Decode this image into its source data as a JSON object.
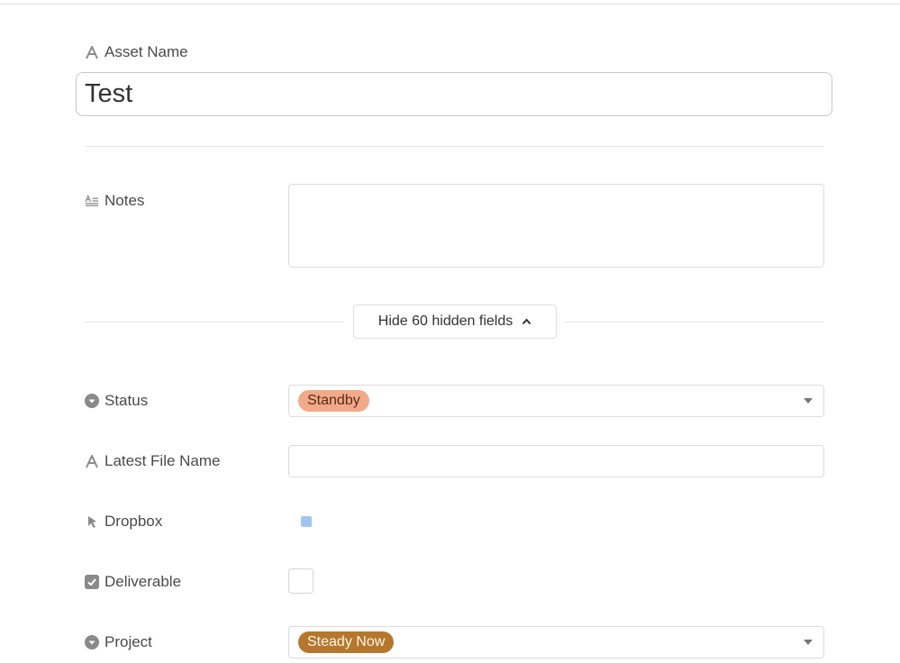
{
  "asset_name": {
    "label": "Asset Name",
    "value": "Test",
    "icon": "text-field-icon"
  },
  "notes": {
    "label": "Notes",
    "value": "",
    "icon": "long-text-icon"
  },
  "hidden_toggle": {
    "label": "Hide 60 hidden fields",
    "icon": "chevron-up-icon"
  },
  "fields": {
    "status": {
      "label": "Status",
      "icon": "single-select-icon",
      "value": "Standby",
      "pill_bg": "#f2a98a",
      "pill_fg": "#5a2a16"
    },
    "latest_file_name": {
      "label": "Latest File Name",
      "icon": "text-field-icon",
      "value": ""
    },
    "dropbox": {
      "label": "Dropbox",
      "icon": "cursor-arrow-icon",
      "swatch_color": "#a3c4f3"
    },
    "deliverable": {
      "label": "Deliverable",
      "icon": "checkbox-icon",
      "checked": false
    },
    "project": {
      "label": "Project",
      "icon": "single-select-icon",
      "value": "Steady Now",
      "pill_bg": "#b5772d",
      "pill_fg": "#fff6e8"
    }
  }
}
